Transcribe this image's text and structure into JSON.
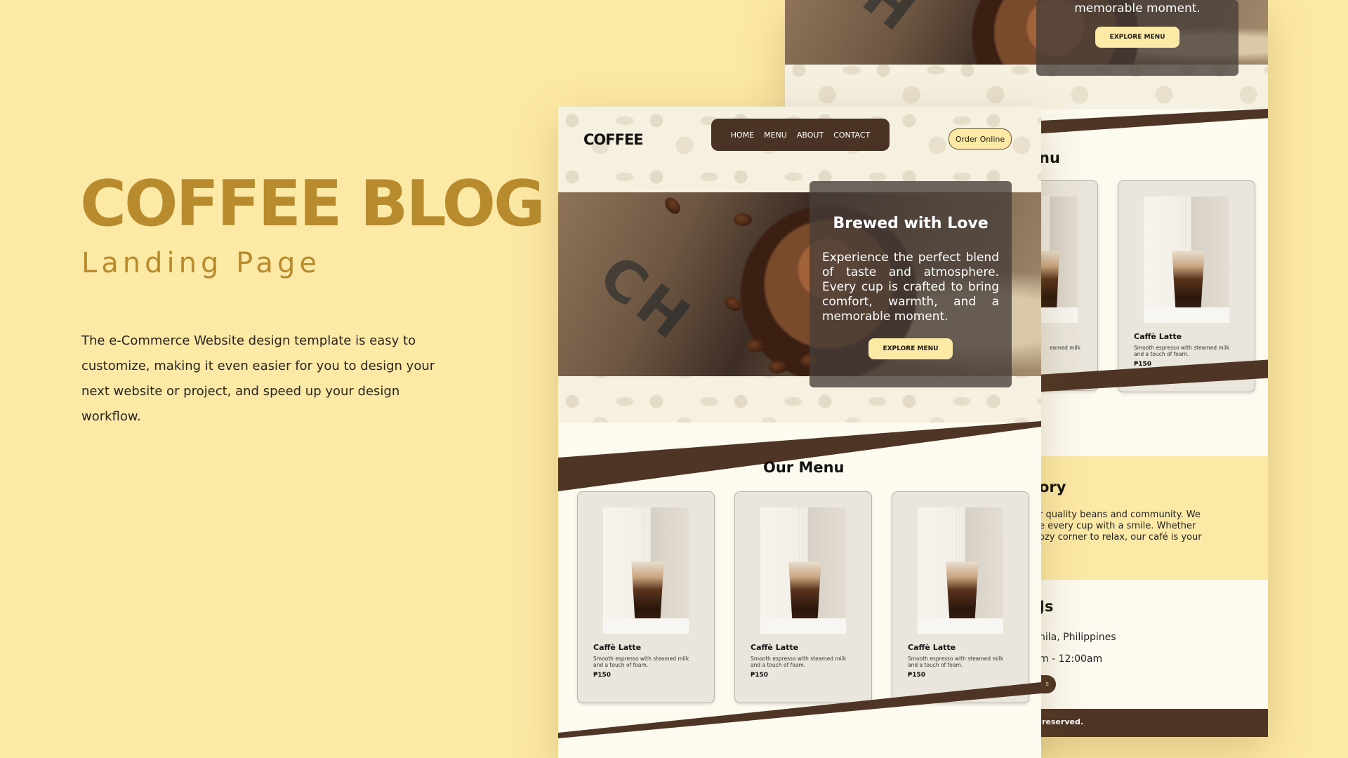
{
  "promo": {
    "title": "COFFEE BLOG",
    "subtitle": "Landing Page",
    "description": "The e-Commerce Website design template is easy to customize, making it even easier for you to design your next website or project, and speed up your design workflow."
  },
  "front": {
    "logo": "COFFEE",
    "nav": [
      "HOME",
      "MENU",
      "ABOUT",
      "CONTACT"
    ],
    "order_button": "Order Online",
    "hero": {
      "title": "Brewed with Love",
      "text": "Experience the perfect blend of taste and atmosphere. Every cup is crafted to bring comfort, warmth, and a memorable moment.",
      "button": "EXPLORE MENU"
    },
    "menu_title": "Our Menu",
    "cards": [
      {
        "name": "Caffè Latte",
        "desc": "Smooth espresso with steamed milk and a touch of foam.",
        "price": "₱150"
      },
      {
        "name": "Caffè Latte",
        "desc": "Smooth espresso with steamed milk and a touch of foam.",
        "price": "₱150"
      },
      {
        "name": "Caffè Latte",
        "desc": "Smooth espresso with steamed milk and a touch of foam.",
        "price": "₱150"
      }
    ]
  },
  "back": {
    "hero_text_tail": "memorable moment.",
    "hero_button": "EXPLORE MENU",
    "menu_title_partial": "nu",
    "card_desc_partial": "eamed milk",
    "card": {
      "name": "Caffè Latte",
      "desc": "Smooth espresso with steamed milk and a touch of foam.",
      "price": "₱150"
    },
    "story_title_partial": "ory",
    "story_lines": [
      "r quality beans and community. We",
      "e every cup with a smile. Whether",
      "ozy corner to relax, our café is your"
    ],
    "contact_title_partial": "Js",
    "contact_address_partial": "nila, Philippines",
    "contact_hours_partial": "m - 12:00am",
    "contact_button_partial": "s",
    "footer_partial": "reserved."
  },
  "colors": {
    "background": "#fde9a6",
    "accent_gold": "#b88c2e",
    "brown": "#4e3526",
    "cream": "#fdfaf0"
  }
}
